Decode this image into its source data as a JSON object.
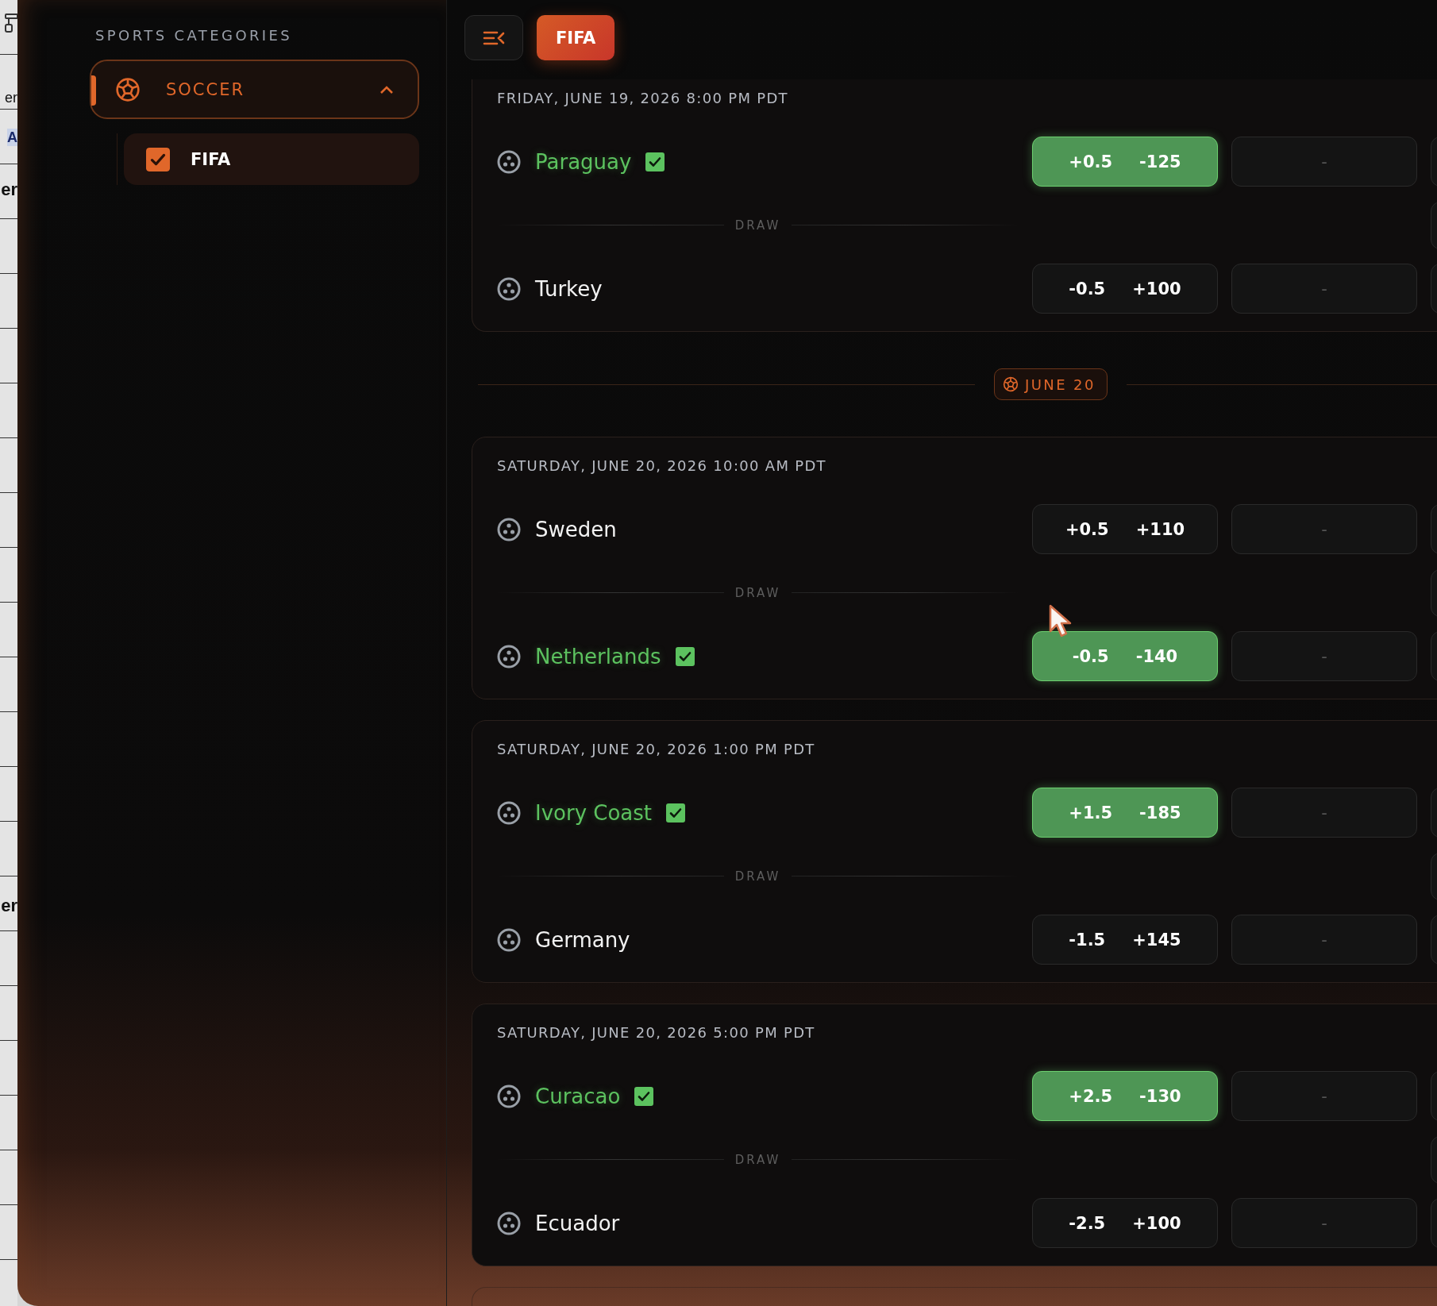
{
  "background_window": {
    "texts": [
      "er",
      "A",
      "er",
      "er"
    ]
  },
  "sidebar": {
    "heading": "SPORTS CATEGORIES",
    "categories": [
      {
        "label": "SOCCER",
        "expanded": true,
        "selected": true,
        "children": [
          {
            "label": "FIFA",
            "checked": true
          }
        ]
      }
    ]
  },
  "toolbar": {
    "filters": [
      {
        "label": "FIFA",
        "selected": true
      }
    ]
  },
  "events": [
    {
      "kind": "match",
      "date": "FRIDAY, JUNE 19, 2026 8:00 PM PDT",
      "cut_top": true,
      "draw_label": "DRAW",
      "teams": [
        {
          "name": "Paraguay",
          "checked": true,
          "odds": [
            {
              "line": "+0.5",
              "price": "-125",
              "selected": true
            },
            {
              "line": "-"
            }
          ]
        },
        {
          "name": "Turkey",
          "checked": false,
          "odds": [
            {
              "line": "-0.5",
              "price": "+100",
              "selected": false
            },
            {
              "line": "-"
            }
          ]
        }
      ]
    },
    {
      "kind": "date_divider",
      "label": "JUNE 20"
    },
    {
      "kind": "match",
      "date": "SATURDAY, JUNE 20, 2026 10:00 AM PDT",
      "cut_top": false,
      "draw_label": "DRAW",
      "teams": [
        {
          "name": "Sweden",
          "checked": false,
          "odds": [
            {
              "line": "+0.5",
              "price": "+110",
              "selected": false
            },
            {
              "line": "-"
            }
          ]
        },
        {
          "name": "Netherlands",
          "checked": true,
          "odds": [
            {
              "line": "-0.5",
              "price": "-140",
              "selected": true
            },
            {
              "line": "-"
            }
          ]
        }
      ]
    },
    {
      "kind": "match",
      "date": "SATURDAY, JUNE 20, 2026 1:00 PM PDT",
      "cut_top": false,
      "draw_label": "DRAW",
      "teams": [
        {
          "name": "Ivory Coast",
          "checked": true,
          "odds": [
            {
              "line": "+1.5",
              "price": "-185",
              "selected": true
            },
            {
              "line": "-"
            }
          ]
        },
        {
          "name": "Germany",
          "checked": false,
          "odds": [
            {
              "line": "-1.5",
              "price": "+145",
              "selected": false
            },
            {
              "line": "-"
            }
          ]
        }
      ]
    },
    {
      "kind": "match",
      "date": "SATURDAY, JUNE 20, 2026 5:00 PM PDT",
      "cut_top": false,
      "draw_label": "DRAW",
      "teams": [
        {
          "name": "Curacao",
          "checked": true,
          "odds": [
            {
              "line": "+2.5",
              "price": "-130",
              "selected": true
            },
            {
              "line": "-"
            }
          ]
        },
        {
          "name": "Ecuador",
          "checked": false,
          "odds": [
            {
              "line": "-2.5",
              "price": "+100",
              "selected": false
            },
            {
              "line": "-"
            }
          ]
        }
      ]
    }
  ]
}
